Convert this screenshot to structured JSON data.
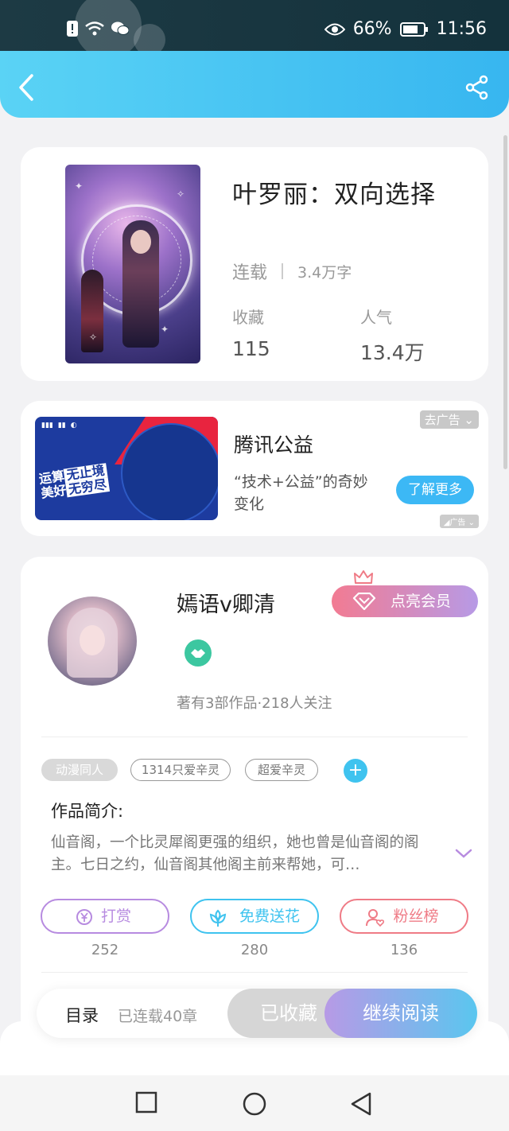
{
  "status_bar": {
    "battery": "66%",
    "time": "11:56"
  },
  "book": {
    "title": "叶罗丽：双向选择",
    "status": "连载",
    "word_count": "3.4万字",
    "favorites_label": "收藏",
    "favorites_value": "115",
    "popularity_label": "人气",
    "popularity_value": "13.4万"
  },
  "ad": {
    "title": "腾讯公益",
    "description": "“技术+公益”的奇妙变化",
    "close_label": "去广告",
    "button_label": "了解更多",
    "image_slogan_1": "运算",
    "image_slogan_2": "无止境",
    "image_slogan_3": "美好",
    "image_slogan_4": "无穷尽",
    "ad_mark": "广告"
  },
  "author": {
    "name": "嫣语v卿清",
    "vip_button": "点亮会员",
    "info": "著有3部作品·218人关注"
  },
  "tags": [
    "动漫同人",
    "1314只爱辛灵",
    "超爱辛灵"
  ],
  "intro": {
    "title": "作品简介:",
    "text": "仙音阁，一个比灵犀阁更强的组织，她也曾是仙音阁的阁主。七日之约，仙音阁其他阁主前来帮她，可…"
  },
  "actions": [
    {
      "label": "打赏",
      "count": "252",
      "color": "#b78be0"
    },
    {
      "label": "免费送花",
      "count": "280",
      "color": "#3fc3ef"
    },
    {
      "label": "粉丝榜",
      "count": "136",
      "color": "#ef7b86"
    }
  ],
  "bottom": {
    "catalog": "目录",
    "chapters": "已连载40章",
    "collected": "已收藏",
    "read": "继续阅读"
  },
  "colors": {
    "header_blue": "#37b6f0",
    "accent_pink": "#f27b92",
    "accent_purple": "#b79ae6"
  },
  "icons": [
    "back-icon",
    "share-icon",
    "crown-icon",
    "diamond-icon",
    "handshake-badge-icon",
    "plus-icon",
    "chevron-down-icon",
    "coin-icon",
    "flower-icon",
    "fan-icon"
  ]
}
